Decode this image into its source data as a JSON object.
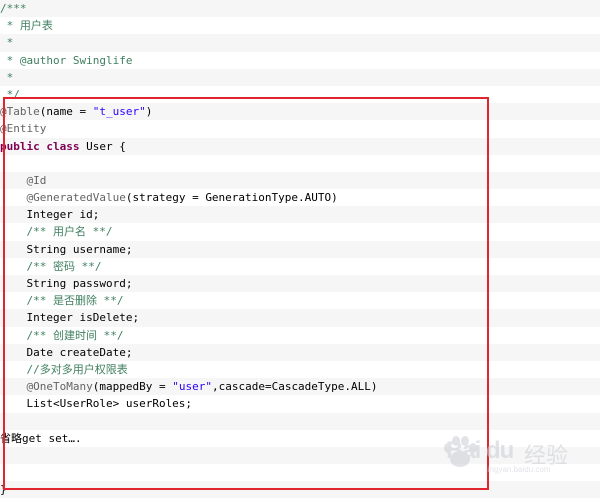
{
  "code": {
    "lines": [
      {
        "parts": [
          {
            "t": "/***",
            "c": "c"
          }
        ],
        "alt": true
      },
      {
        "parts": [
          {
            "t": " * 用户表",
            "c": "c"
          }
        ],
        "alt": false
      },
      {
        "parts": [
          {
            "t": " *",
            "c": "c"
          }
        ],
        "alt": true
      },
      {
        "parts": [
          {
            "t": " * @author Swinglife",
            "c": "c"
          }
        ],
        "alt": false
      },
      {
        "parts": [
          {
            "t": " *",
            "c": "c"
          }
        ],
        "alt": true
      },
      {
        "parts": [
          {
            "t": " */",
            "c": "c"
          }
        ],
        "alt": false
      },
      {
        "parts": [
          {
            "t": "@Table",
            "c": "a"
          },
          {
            "t": "(name = ",
            "c": "p"
          },
          {
            "t": "\"t_user\"",
            "c": "s"
          },
          {
            "t": ")",
            "c": "p"
          }
        ],
        "alt": true
      },
      {
        "parts": [
          {
            "t": "@Entity",
            "c": "a"
          }
        ],
        "alt": false
      },
      {
        "parts": [
          {
            "t": "public",
            "c": "k"
          },
          {
            "t": " ",
            "c": "p"
          },
          {
            "t": "class",
            "c": "k"
          },
          {
            "t": " User {",
            "c": "p"
          }
        ],
        "alt": true
      },
      {
        "parts": [
          {
            "t": "",
            "c": "p"
          }
        ],
        "alt": false
      },
      {
        "parts": [
          {
            "t": "    ",
            "c": "p"
          },
          {
            "t": "@Id",
            "c": "a"
          }
        ],
        "alt": true
      },
      {
        "parts": [
          {
            "t": "    ",
            "c": "p"
          },
          {
            "t": "@GeneratedValue",
            "c": "a"
          },
          {
            "t": "(strategy = GenerationType.AUTO)",
            "c": "p"
          }
        ],
        "alt": false
      },
      {
        "parts": [
          {
            "t": "    Integer id;",
            "c": "p"
          }
        ],
        "alt": true
      },
      {
        "parts": [
          {
            "t": "    ",
            "c": "p"
          },
          {
            "t": "/** 用户名 **/",
            "c": "c"
          }
        ],
        "alt": false
      },
      {
        "parts": [
          {
            "t": "    String username;",
            "c": "p"
          }
        ],
        "alt": true
      },
      {
        "parts": [
          {
            "t": "    ",
            "c": "p"
          },
          {
            "t": "/** 密码 **/",
            "c": "c"
          }
        ],
        "alt": false
      },
      {
        "parts": [
          {
            "t": "    String password;",
            "c": "p"
          }
        ],
        "alt": true
      },
      {
        "parts": [
          {
            "t": "    ",
            "c": "p"
          },
          {
            "t": "/** 是否删除 **/",
            "c": "c"
          }
        ],
        "alt": false
      },
      {
        "parts": [
          {
            "t": "    Integer isDelete;",
            "c": "p"
          }
        ],
        "alt": true
      },
      {
        "parts": [
          {
            "t": "    ",
            "c": "p"
          },
          {
            "t": "/** 创建时间 **/",
            "c": "c"
          }
        ],
        "alt": false
      },
      {
        "parts": [
          {
            "t": "    Date createDate;",
            "c": "p"
          }
        ],
        "alt": true
      },
      {
        "parts": [
          {
            "t": "    ",
            "c": "p"
          },
          {
            "t": "//多对多用户权限表",
            "c": "c"
          }
        ],
        "alt": false
      },
      {
        "parts": [
          {
            "t": "    ",
            "c": "p"
          },
          {
            "t": "@OneToMany",
            "c": "a"
          },
          {
            "t": "(mappedBy = ",
            "c": "p"
          },
          {
            "t": "\"user\"",
            "c": "s"
          },
          {
            "t": ",cascade=CascadeType.ALL)",
            "c": "p"
          }
        ],
        "alt": true
      },
      {
        "parts": [
          {
            "t": "    List<UserRole> userRoles;",
            "c": "p"
          }
        ],
        "alt": false
      },
      {
        "parts": [
          {
            "t": "",
            "c": "p"
          }
        ],
        "alt": true
      },
      {
        "parts": [
          {
            "t": "省略get set….",
            "c": "p"
          }
        ],
        "alt": false
      },
      {
        "parts": [
          {
            "t": "",
            "c": "p"
          }
        ],
        "alt": true
      },
      {
        "parts": [
          {
            "t": "",
            "c": "p"
          }
        ],
        "alt": false
      },
      {
        "parts": [
          {
            "t": "}",
            "c": "p"
          }
        ],
        "alt": true
      }
    ]
  },
  "colors": {
    "comment": "#3f7f5f",
    "annotation": "#646464",
    "keyword": "#7f0055",
    "string": "#2a00ff",
    "highlight_border": "#e0252f"
  },
  "watermark": {
    "logo": "Bai du",
    "name": "经验",
    "url": "jingyan.baidu.com",
    "icon": "paw-icon"
  }
}
